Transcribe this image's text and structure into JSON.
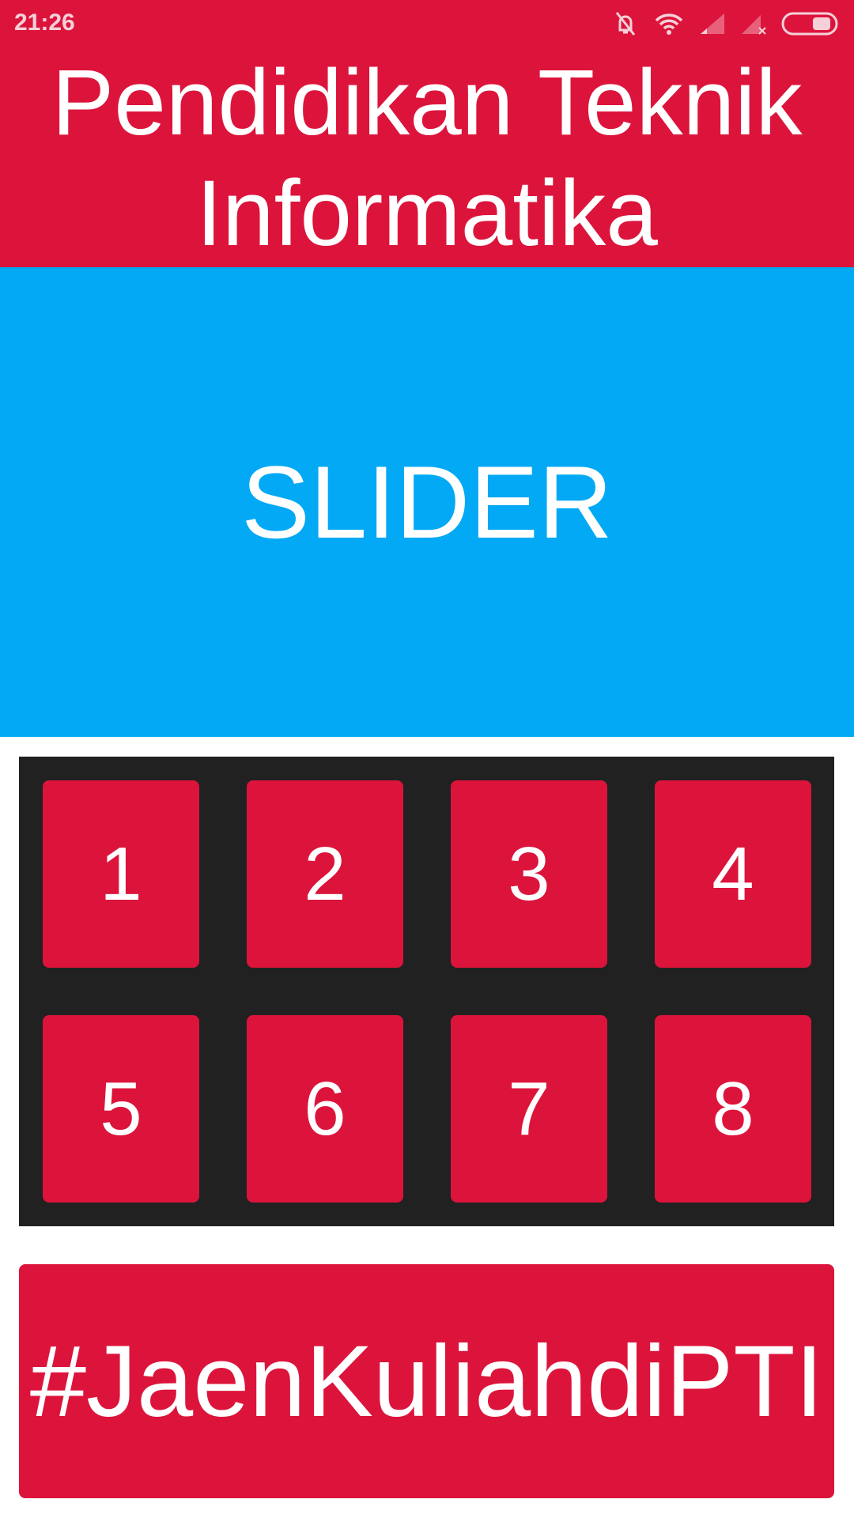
{
  "status_bar": {
    "time": "21:26",
    "icons": [
      "mute-bell-icon",
      "wifi-icon",
      "signal-icon",
      "signal-no-sim-icon",
      "battery-icon"
    ]
  },
  "header": {
    "title": "Pendidikan Teknik Informatika"
  },
  "slider": {
    "label": "SLIDER"
  },
  "menu": {
    "items": [
      "1",
      "2",
      "3",
      "4",
      "5",
      "6",
      "7",
      "8"
    ]
  },
  "cta": {
    "label": "#JaenKuliahdiPTI"
  },
  "colors": {
    "primary": "#DC143C",
    "slider": "#03A9F4",
    "grid_bg": "#212121"
  }
}
